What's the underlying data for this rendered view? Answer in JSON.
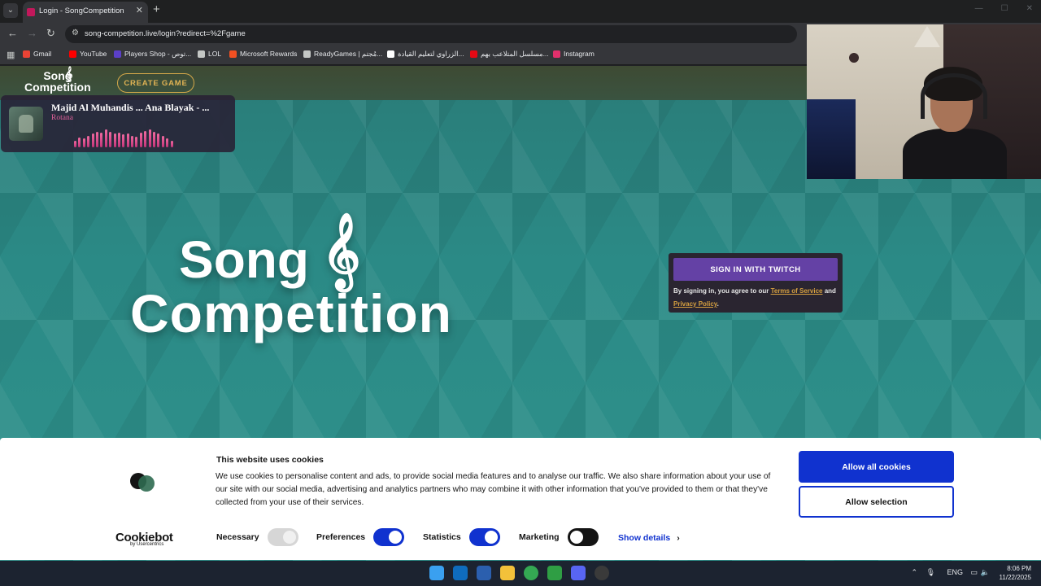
{
  "browser": {
    "tab": {
      "title": "Login - SongCompetition"
    },
    "url": "song-competition.live/login?redirect=%2Fgame",
    "bookmarks": [
      {
        "label": "Gmail",
        "icon": "gmail-icon",
        "color": "#ea4335"
      },
      {
        "label": "YouTube",
        "icon": "youtube-icon",
        "color": "#ff0000"
      },
      {
        "label": "Players Shop - توص...",
        "icon": "players-shop-icon",
        "color": "#5b3fc8"
      },
      {
        "label": "LOL",
        "icon": "lol-icon",
        "color": "#c4c7c5"
      },
      {
        "label": "Microsoft Rewards",
        "icon": "microsoft-icon",
        "color": "#f25022"
      },
      {
        "label": "ReadyGames | مُجتم...",
        "icon": "readygames-icon",
        "color": "#c4c7c5"
      },
      {
        "label": "الزراوي لتعليم القيادة...",
        "icon": "driving-school-icon",
        "color": "#ffffff"
      },
      {
        "label": "مسلسل المتلاعب بهم...",
        "icon": "series-icon",
        "color": "#e50914"
      },
      {
        "label": "Instagram",
        "icon": "instagram-icon",
        "color": "#e1306c"
      }
    ]
  },
  "site": {
    "logo": {
      "line1": "Song",
      "line2": "Competition",
      "clef": "𝄞"
    },
    "create_game": "CREATE GAME",
    "hero": {
      "line1": "Song",
      "line2": "Competition",
      "clef": "𝄞"
    },
    "signin": {
      "button": "SIGN IN WITH TWITCH",
      "prefix": "By signing in, you agree to our ",
      "tos": "Terms of Service",
      "and": " and",
      "privacy": "Privacy Policy",
      "suffix": "."
    }
  },
  "now_playing": {
    "title": "Majid Al Muhandis ... Ana Blayak - ...",
    "artist": "Rotana",
    "wave_levels": [
      0.35,
      0.5,
      0.45,
      0.6,
      0.7,
      0.8,
      0.75,
      0.9,
      0.8,
      0.7,
      0.75,
      0.65,
      0.7,
      0.6,
      0.55,
      0.75,
      0.85,
      0.9,
      0.8,
      0.7,
      0.6,
      0.45,
      0.35
    ]
  },
  "cookie": {
    "title": "This website uses cookies",
    "text": "We use cookies to personalise content and ads, to provide social media features and to analyse our traffic. We also share information about your use of our site with our social media, advertising and analytics partners who may combine it with other information that you've provided to them or that they've collected from your use of their services.",
    "brand": "Cookiebot",
    "brand_sub": "by Usercentrics",
    "toggles": [
      {
        "label": "Necessary",
        "state": "disabled-on"
      },
      {
        "label": "Preferences",
        "state": "on"
      },
      {
        "label": "Statistics",
        "state": "on"
      },
      {
        "label": "Marketing",
        "state": "off"
      }
    ],
    "show_details": "Show details",
    "allow_all": "Allow all cookies",
    "allow_selection": "Allow selection"
  },
  "taskbar": {
    "apps": [
      "windows-start-icon",
      "outlook-icon",
      "store-icon",
      "file-explorer-icon",
      "chrome-icon",
      "xbox-icon",
      "discord-icon",
      "obs-icon"
    ],
    "lang": "ENG",
    "time": "8:06 PM",
    "date": "11/22/2025"
  }
}
